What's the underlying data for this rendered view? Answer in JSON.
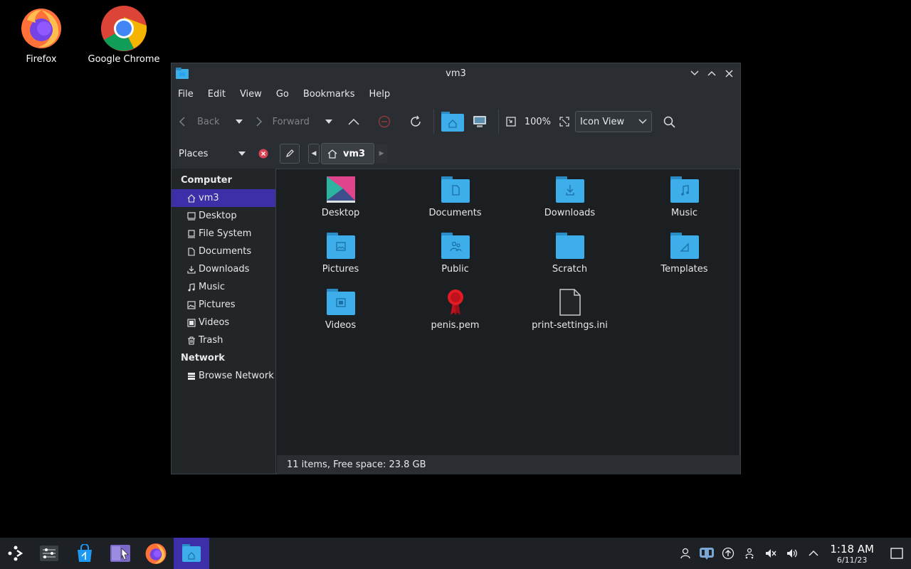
{
  "desktop": {
    "icons": [
      {
        "label": "Firefox"
      },
      {
        "label": "Google Chrome"
      }
    ]
  },
  "window": {
    "title": "vm3",
    "menu": [
      "File",
      "Edit",
      "View",
      "Go",
      "Bookmarks",
      "Help"
    ],
    "toolbar": {
      "back": "Back",
      "forward": "Forward",
      "zoom": "100%",
      "view_mode": "Icon View"
    },
    "places_label": "Places",
    "breadcrumb": "vm3",
    "sidebar": {
      "groups": [
        {
          "title": "Computer",
          "items": [
            {
              "label": "vm3",
              "icon": "home-icon",
              "selected": true
            },
            {
              "label": "Desktop",
              "icon": "desktop-icon"
            },
            {
              "label": "File System",
              "icon": "drive-icon"
            },
            {
              "label": "Documents",
              "icon": "document-icon"
            },
            {
              "label": "Downloads",
              "icon": "download-icon"
            },
            {
              "label": "Music",
              "icon": "music-icon"
            },
            {
              "label": "Pictures",
              "icon": "picture-icon"
            },
            {
              "label": "Videos",
              "icon": "video-icon"
            },
            {
              "label": "Trash",
              "icon": "trash-icon"
            }
          ]
        },
        {
          "title": "Network",
          "items": [
            {
              "label": "Browse Network",
              "icon": "network-icon"
            }
          ]
        }
      ]
    },
    "files": [
      {
        "name": "Desktop",
        "icon": "desktop-folder-icon"
      },
      {
        "name": "Documents",
        "icon": "documents-folder-icon"
      },
      {
        "name": "Downloads",
        "icon": "downloads-folder-icon"
      },
      {
        "name": "Music",
        "icon": "music-folder-icon"
      },
      {
        "name": "Pictures",
        "icon": "pictures-folder-icon"
      },
      {
        "name": "Public",
        "icon": "public-folder-icon"
      },
      {
        "name": "Scratch",
        "icon": "folder-icon"
      },
      {
        "name": "Templates",
        "icon": "templates-folder-icon"
      },
      {
        "name": "Videos",
        "icon": "videos-folder-icon"
      },
      {
        "name": "penis.pem",
        "icon": "certificate-icon"
      },
      {
        "name": "print-settings.ini",
        "icon": "text-file-icon"
      }
    ],
    "status": "11 items, Free space: 23.8 GB"
  },
  "taskbar": {
    "time": "1:18 AM",
    "date": "6/11/23"
  },
  "colors": {
    "accent": "#3c2fa8",
    "folder": "#3daee9",
    "background": "#232629"
  }
}
